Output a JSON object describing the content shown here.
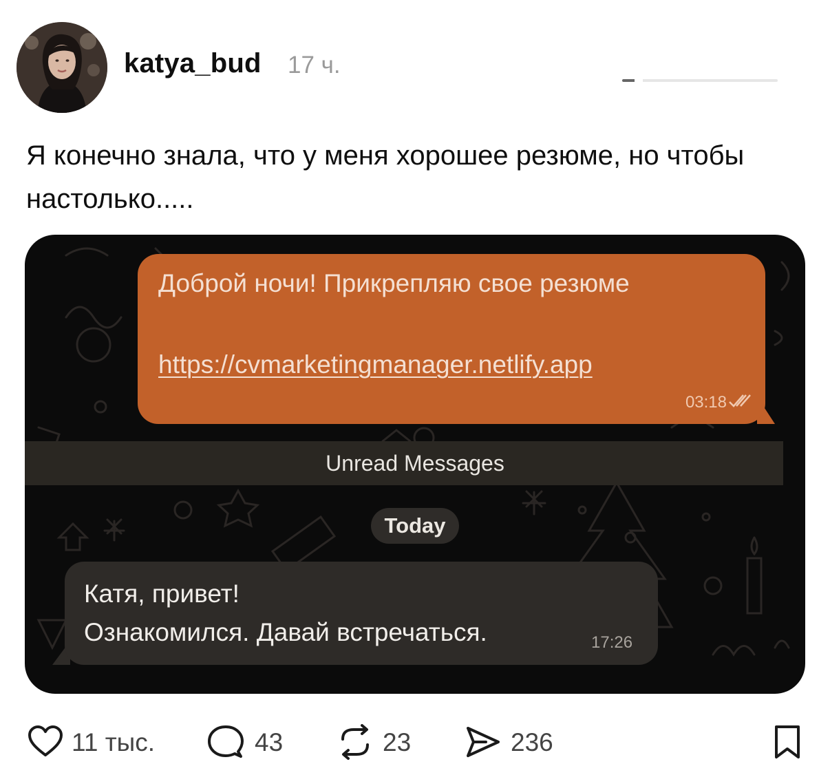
{
  "post": {
    "username": "katya_bud",
    "timestamp": "17 ч.",
    "text": "Я конечно знала, что у меня хорошее резюме, но чтобы настолько....."
  },
  "chat": {
    "outgoing": {
      "text": "Доброй ночи! Прикрепляю свое резюме",
      "link": "https://cvmarketingmanager.netlify.app",
      "time": "03:18"
    },
    "unread_label": "Unread Messages",
    "date_label": "Today",
    "incoming": {
      "line1": "Катя, привет!",
      "line2": "Ознакомился. Давай встречаться.",
      "time": "17:26"
    }
  },
  "actions": {
    "likes": "11 тыс.",
    "replies": "43",
    "reposts": "23",
    "shares": "236"
  },
  "colors": {
    "outgoing_bubble": "#c2612a",
    "incoming_bubble": "#2e2b28",
    "chat_background": "#0b0b0b"
  }
}
